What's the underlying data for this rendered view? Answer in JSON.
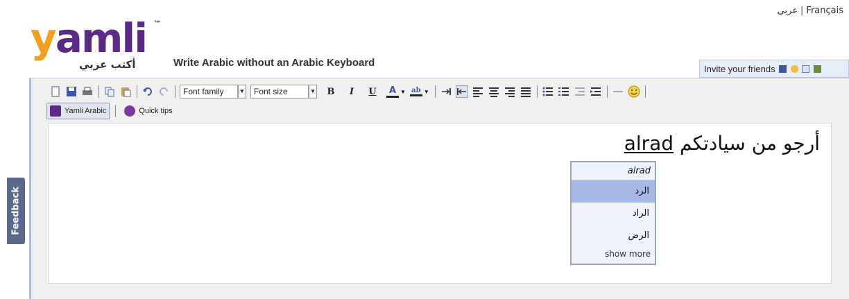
{
  "header": {
    "lang_arabic": "عربي",
    "lang_separator": "|",
    "lang_french": "Français",
    "logo_letters": "yamli",
    "logo_tm": "™",
    "logo_arabic": "أكتب عربي",
    "tagline": "Write Arabic without an Arabic Keyboard",
    "invite_label": "Invite your friends"
  },
  "toolbar": {
    "font_family": "Font family",
    "font_size": "Font size",
    "bold": "B",
    "italic": "I",
    "underline": "U",
    "text_color": "A",
    "highlight": "ab"
  },
  "toolbar2": {
    "yamli_arabic": "Yamli Arabic",
    "quick_tips": "Quick tips"
  },
  "editor": {
    "arabic_text": "أرجو من سيادتكم",
    "latin_text": "alrad"
  },
  "suggestions": {
    "typed": "alrad",
    "options": [
      "الرد",
      "الراد",
      "الرض"
    ],
    "highlighted_index": 0,
    "show_more": "show more"
  },
  "feedback": {
    "label": "Feedback"
  },
  "colors": {
    "logo_y": "#f0a020",
    "logo_text": "#5a2a85",
    "highlight": "#a7b8e6",
    "feedback_bg": "#5b6a8c"
  }
}
